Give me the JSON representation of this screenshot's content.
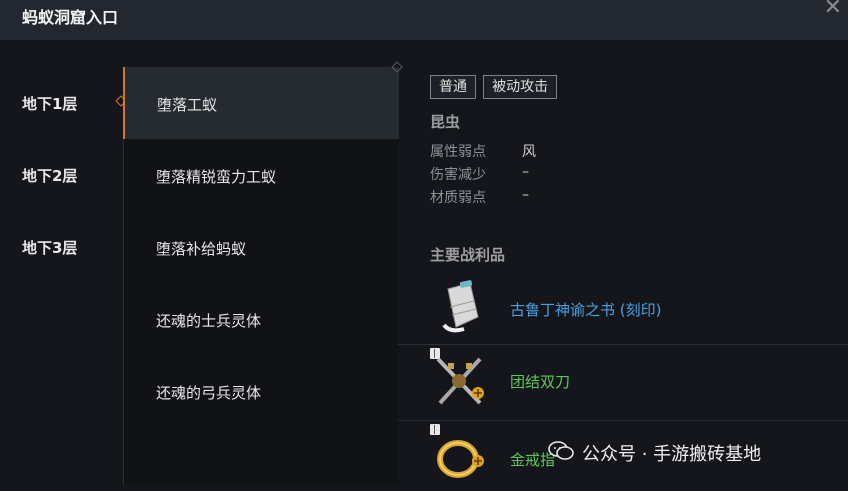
{
  "window": {
    "title": "蚂蚁洞窟入口",
    "close_icon": "close-icon"
  },
  "floors": [
    {
      "label": "地下1层",
      "active": true
    },
    {
      "label": "地下2层",
      "active": false
    },
    {
      "label": "地下3层",
      "active": false
    }
  ],
  "monsters": [
    {
      "name": "堕落工蚁",
      "active": true
    },
    {
      "name": "堕落精锐蛮力工蚁",
      "active": false
    },
    {
      "name": "堕落补给蚂蚁",
      "active": false
    },
    {
      "name": "还魂的士兵灵体",
      "active": false
    },
    {
      "name": "还魂的弓兵灵体",
      "active": false
    }
  ],
  "detail": {
    "tags": [
      "普通",
      "被动攻击"
    ],
    "type": "昆虫",
    "attributes": [
      {
        "label": "属性弱点",
        "value": "风"
      },
      {
        "label": "伤害减少",
        "value": "–"
      },
      {
        "label": "材质弱点",
        "value": "–"
      }
    ],
    "loot_title": "主要战利品",
    "loot": [
      {
        "name": "古鲁丁神谕之书 (刻印)",
        "color": "#4a9fe0",
        "icon": "scroll-icon"
      },
      {
        "name": "团结双刀",
        "color": "#5cc858",
        "icon": "dual-blades-icon"
      },
      {
        "name": "金戒指",
        "color": "#5cc858",
        "icon": "gold-ring-icon"
      }
    ]
  },
  "watermark": {
    "text": "公众号 · 手游搬砖基地",
    "icon": "wechat-icon"
  },
  "colors": {
    "accent": "#d07a2a",
    "blue_item": "#4a9fe0",
    "green_item": "#5cc858"
  }
}
